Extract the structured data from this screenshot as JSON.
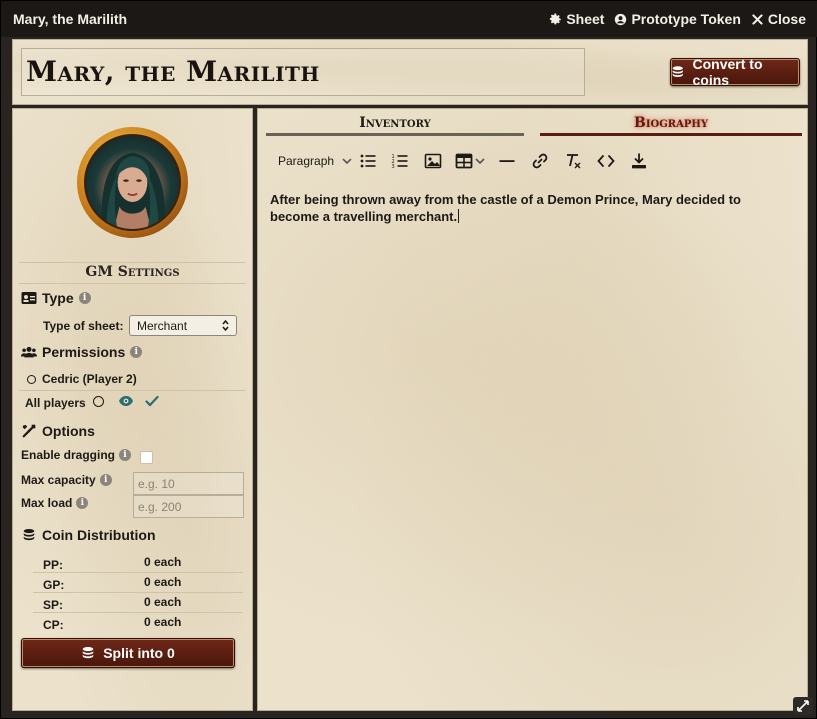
{
  "window": {
    "title": "Mary, the Marilith",
    "controls": [
      {
        "label": "Sheet",
        "icon": "gear-icon"
      },
      {
        "label": "Prototype Token",
        "icon": "user-circle-icon"
      },
      {
        "label": "Close",
        "icon": "close-icon"
      }
    ]
  },
  "header": {
    "name": "Mary, the Marilith",
    "convert_button": "Convert to coins"
  },
  "gm_settings": {
    "title": "GM Settings",
    "type": {
      "heading": "Type",
      "sheet_label": "Type of sheet:",
      "sheet_value": "Merchant"
    },
    "permissions": {
      "heading": "Permissions",
      "player": "Cedric (Player 2)",
      "all_players": "All players"
    },
    "options": {
      "heading": "Options",
      "enable_dragging": "Enable dragging",
      "max_capacity": "Max capacity",
      "max_capacity_placeholder": "e.g. 10",
      "max_load": "Max load",
      "max_load_placeholder": "e.g. 200"
    },
    "coin_distribution": {
      "heading": "Coin Distribution",
      "rows": [
        {
          "label": "PP:",
          "value": "0 each"
        },
        {
          "label": "GP:",
          "value": "0 each"
        },
        {
          "label": "SP:",
          "value": "0 each"
        },
        {
          "label": "CP:",
          "value": "0 each"
        }
      ],
      "split_button": "Split into 0"
    }
  },
  "tabs": {
    "inventory": "Inventory",
    "biography": "Biography",
    "active": "biography"
  },
  "editor": {
    "format_select": "Paragraph",
    "content": "After being thrown away from the castle of a Demon Prince, Mary decided to become a travelling merchant."
  },
  "colors": {
    "accent": "#5a1d12",
    "active_tab_glow": "#c0392b",
    "parchment": "#ece2cc",
    "teal_icon": "#2b6f73"
  }
}
